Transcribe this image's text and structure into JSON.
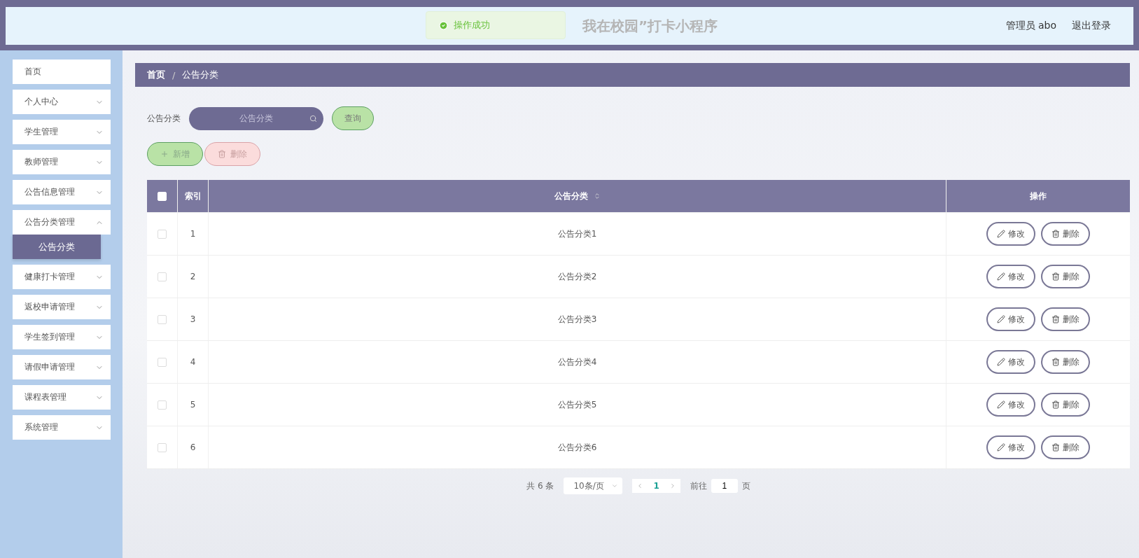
{
  "header": {
    "title": "我在校园”打卡小程序",
    "user": "管理员 abo",
    "logout": "退出登录"
  },
  "toast": {
    "kind": "success",
    "text": "操作成功"
  },
  "sidebar": {
    "items": [
      {
        "label": "首页",
        "expandable": false
      },
      {
        "label": "个人中心",
        "expandable": true,
        "expanded": false
      },
      {
        "label": "学生管理",
        "expandable": true,
        "expanded": false
      },
      {
        "label": "教师管理",
        "expandable": true,
        "expanded": false
      },
      {
        "label": "公告信息管理",
        "expandable": true,
        "expanded": false
      },
      {
        "label": "公告分类管理",
        "expandable": true,
        "expanded": true,
        "children": [
          {
            "label": "公告分类",
            "selected": true
          }
        ]
      },
      {
        "label": "健康打卡管理",
        "expandable": true,
        "expanded": false
      },
      {
        "label": "返校申请管理",
        "expandable": true,
        "expanded": false
      },
      {
        "label": "学生签到管理",
        "expandable": true,
        "expanded": false
      },
      {
        "label": "请假申请管理",
        "expandable": true,
        "expanded": false
      },
      {
        "label": "课程表管理",
        "expandable": true,
        "expanded": false
      },
      {
        "label": "系统管理",
        "expandable": true,
        "expanded": false
      }
    ]
  },
  "breadcrumb": {
    "items": [
      "首页",
      "公告分类"
    ],
    "separator": "/"
  },
  "search": {
    "label": "公告分类",
    "placeholder": "公告分类",
    "button": "查询"
  },
  "actions": [
    {
      "kind": "add",
      "label": "新增"
    },
    {
      "kind": "delete",
      "label": "删除"
    }
  ],
  "table": {
    "columns": [
      "索引",
      "公告分类",
      "操作"
    ],
    "all_checked": false,
    "rows": [
      {
        "index": "1",
        "name": "公告分类1",
        "checked": false,
        "actions": [
          {
            "kind": "edit",
            "label": "修改"
          },
          {
            "kind": "delete",
            "label": "删除"
          }
        ]
      },
      {
        "index": "2",
        "name": "公告分类2",
        "checked": false,
        "actions": [
          {
            "kind": "edit",
            "label": "修改"
          },
          {
            "kind": "delete",
            "label": "删除"
          }
        ]
      },
      {
        "index": "3",
        "name": "公告分类3",
        "checked": false,
        "actions": [
          {
            "kind": "edit",
            "label": "修改"
          },
          {
            "kind": "delete",
            "label": "删除"
          }
        ]
      },
      {
        "index": "4",
        "name": "公告分类4",
        "checked": false,
        "actions": [
          {
            "kind": "edit",
            "label": "修改"
          },
          {
            "kind": "delete",
            "label": "删除"
          }
        ]
      },
      {
        "index": "5",
        "name": "公告分类5",
        "checked": false,
        "actions": [
          {
            "kind": "edit",
            "label": "修改"
          },
          {
            "kind": "delete",
            "label": "删除"
          }
        ]
      },
      {
        "index": "6",
        "name": "公告分类6",
        "checked": false,
        "actions": [
          {
            "kind": "edit",
            "label": "修改"
          },
          {
            "kind": "delete",
            "label": "删除"
          }
        ]
      }
    ]
  },
  "pagination": {
    "total": "共 6 条",
    "page_size": "10条/页",
    "pages": [
      {
        "label": "1",
        "selected": true
      }
    ],
    "goto_label": "前往",
    "goto_value": "1",
    "goto_suffix": "页"
  }
}
